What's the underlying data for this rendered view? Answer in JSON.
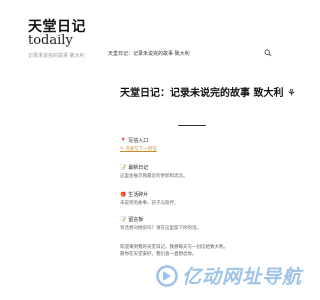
{
  "sidebar": {
    "brand_cn": "天堂日记",
    "brand_en": "todaily",
    "tagline": "记录未说完的故事 致大利"
  },
  "topbar": {
    "breadcrumb": "天堂日记：记录未说完的故事 致大利",
    "search_icon": "search-icon"
  },
  "article": {
    "title": "天堂日记：记录未说完的故事 致大利 ⚘"
  },
  "sections": [
    {
      "icon": "📍",
      "icon_name": "pin-icon",
      "heading": "写信入口",
      "link": "✎ 点此写下一封信"
    },
    {
      "icon": "📝",
      "icon_name": "memo-icon",
      "heading": "最新日记",
      "line": "这里会展示我最近的更新和思念。"
    },
    {
      "icon": "🎁",
      "icon_name": "gift-icon",
      "heading": "生活碎片",
      "line": "未说完的故事、孩子与陪伴。"
    },
    {
      "icon": "📝",
      "icon_name": "note-icon",
      "heading": "留言板",
      "line": "有话想对她说吗？请在这里留下你的话。"
    }
  ],
  "welcome": {
    "line1": "欢迎来到我的天堂日记，我想每天写一封信给致大利。",
    "line2": "愿你在天堂安好，我们会一直想念你。"
  },
  "watermark": {
    "text": "亿动网址导航",
    "color": "#9ec3ea"
  }
}
